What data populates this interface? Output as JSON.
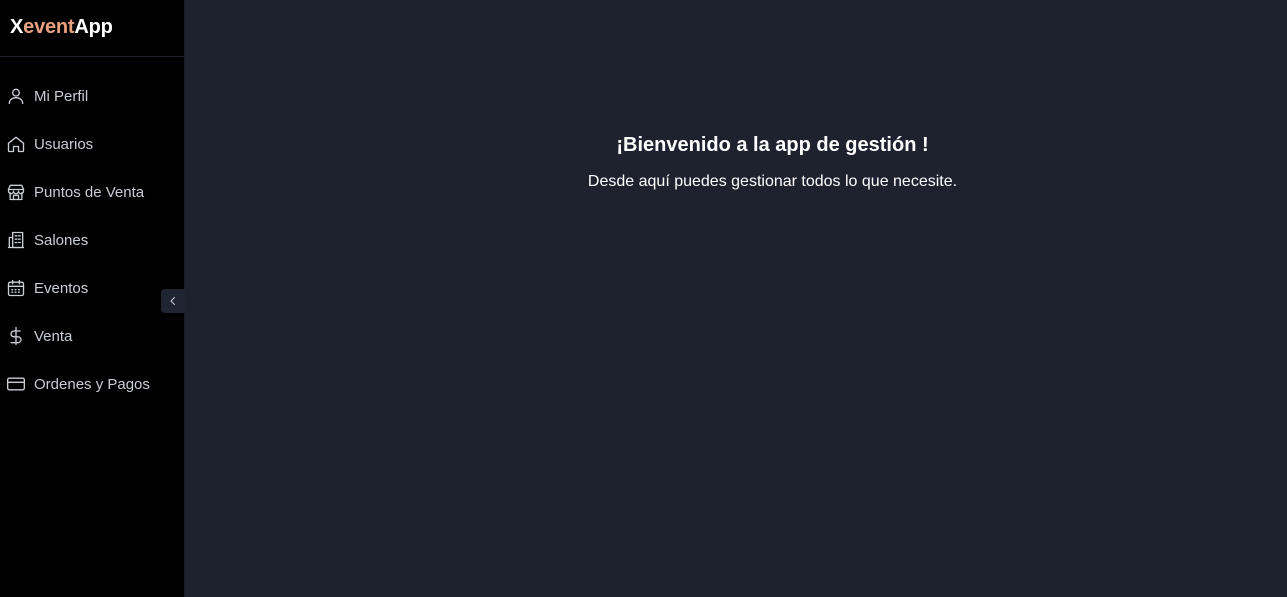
{
  "brand": {
    "part1": "X",
    "part2": "event",
    "part3": "App",
    "accent_color": "#e8a07f"
  },
  "sidebar": {
    "items": [
      {
        "label": "Mi Perfil",
        "icon": "user-icon"
      },
      {
        "label": "Usuarios",
        "icon": "home-icon"
      },
      {
        "label": "Puntos de Venta",
        "icon": "store-icon"
      },
      {
        "label": "Salones",
        "icon": "building-icon"
      },
      {
        "label": "Eventos",
        "icon": "calendar-icon"
      },
      {
        "label": "Venta",
        "icon": "dollar-icon"
      },
      {
        "label": "Ordenes y Pagos",
        "icon": "credit-card-icon"
      }
    ],
    "collapse_icon": "chevron-left-icon"
  },
  "main": {
    "title": "¡Bienvenido a la app de gestión !",
    "subtitle": "Desde aquí puedes gestionar todos lo que necesite."
  },
  "colors": {
    "sidebar_bg": "#000000",
    "main_bg": "#1e222f",
    "text": "#ffffff",
    "nav_text": "#c9cdd4"
  }
}
